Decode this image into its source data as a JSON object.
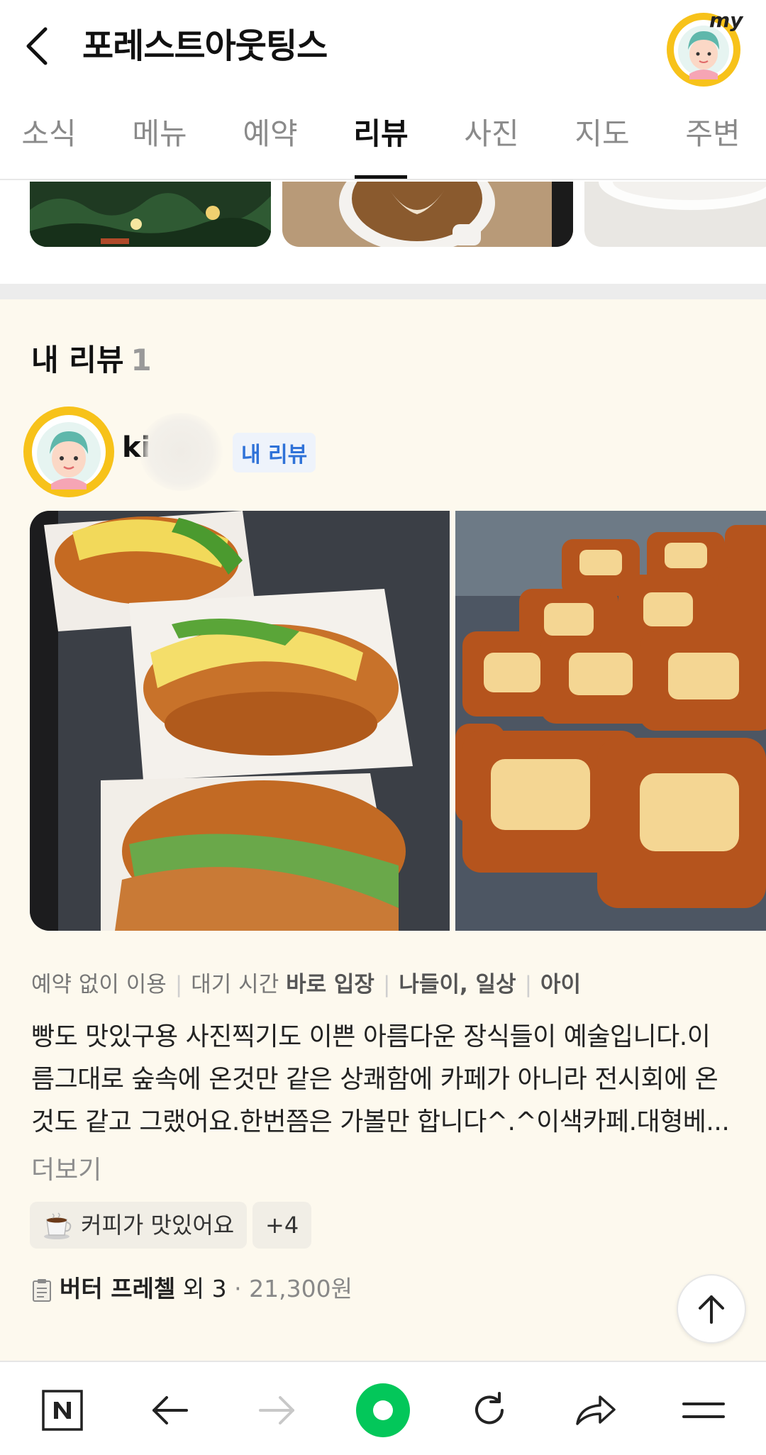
{
  "header": {
    "title": "포레스트아웃팅스",
    "my_badge": "my"
  },
  "tabs": [
    {
      "label": "소식",
      "active": false
    },
    {
      "label": "메뉴",
      "active": false
    },
    {
      "label": "예약",
      "active": false
    },
    {
      "label": "리뷰",
      "active": true
    },
    {
      "label": "사진",
      "active": false
    },
    {
      "label": "지도",
      "active": false
    },
    {
      "label": "주변",
      "active": false
    }
  ],
  "review_section": {
    "title": "내 리뷰",
    "count": "1"
  },
  "review": {
    "author_name": "ki",
    "badge": "내 리뷰",
    "meta": {
      "reservation": "예약 없이 이용",
      "wait_prefix": "대기 시간",
      "wait_value": "바로 입장",
      "purpose": "나들이, 일상",
      "companion": "아이"
    },
    "body_lines": [
      "빵도 맛있구용 사진찍기도 이쁜 아름다운 장식들이 예술입니다.이",
      "름그대로 숲속에 온것만 같은 상쾌함에 카페가 아니라 전시회에 온",
      "것도 같고 그랬어요.한번쯤은 가볼만 합니다^.^이색카페.대형베..."
    ],
    "more_label": "더보기",
    "keyword_chip": "커피가 맛있어요",
    "extra_count_chip": "+4",
    "receipt_item": "버터 프레첼",
    "receipt_more": "외 3",
    "receipt_price": "21,300원"
  },
  "colors": {
    "review_bg": "#fdf9ee",
    "accent_blue": "#2f72d8",
    "naver_green": "#03c75a"
  },
  "icons": {
    "back": "chevron-left-icon",
    "scroll_top": "arrow-up-icon",
    "bottom_bar": [
      "naver-n-icon",
      "arrow-left-icon",
      "arrow-right-icon",
      "green-dot-icon",
      "refresh-icon",
      "share-icon",
      "menu-icon"
    ]
  }
}
